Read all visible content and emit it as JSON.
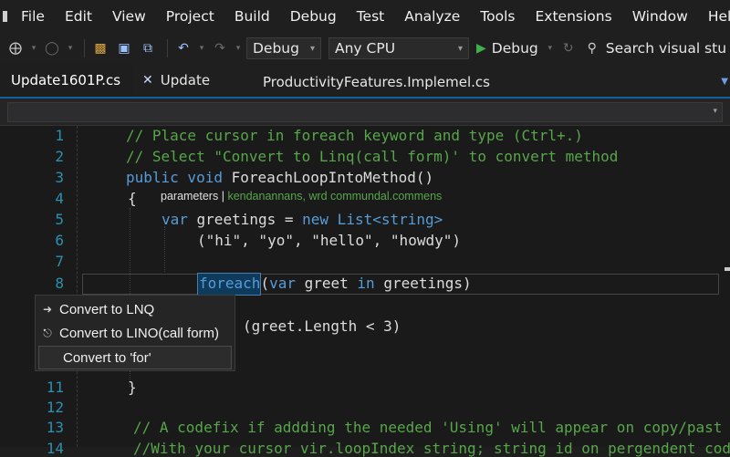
{
  "menu": [
    "File",
    "Edit",
    "View",
    "Project",
    "Build",
    "Debug",
    "Test",
    "Analyze",
    "Tools",
    "Extensions",
    "Window",
    "Help"
  ],
  "toolbar": {
    "configuration": "Debug",
    "platform": "Any CPU",
    "run_label": "Debug",
    "search_label": "Search visual stu"
  },
  "tabs": [
    {
      "label": "Update1601P.cs",
      "active": true
    },
    {
      "label": "Update",
      "active": false
    },
    {
      "label": "ProductivityFeatures.Implemel.cs",
      "active": false
    }
  ],
  "editor": {
    "line_numbers": [
      "1",
      "2",
      "3",
      "4",
      "5",
      "6",
      "7",
      "8",
      "11",
      "12",
      "13",
      "14"
    ],
    "lines": {
      "l1": "// Place cursor in foreach keyword and type (Ctrl+.)",
      "l2": "// Select \"Convert to Linq(call form)' to convert method",
      "l3_kw": "public void",
      "l3_name": " ForeachLoopIntoMethod()",
      "l4": "{",
      "l5_kw": "var",
      "l5_mid": " greetings = ",
      "l5_new": "new",
      "l5_type": " List<string>",
      "l6": "(\"hi\", \"yo\", \"hello\", \"howdy\")",
      "l8_kw": "foreach",
      "l8_open": "(",
      "l8_var": "var",
      "l8_mid": " greet ",
      "l8_in": "in",
      "l8_rest": " greetings)",
      "l9_rest": "(greet.Length < 3)",
      "l11": "}",
      "l13": "// A codefix if addding the needed 'Using' will appear on copy/past",
      "l14": "//With your cursor vir.loopIndex string; string id on pergendent code"
    },
    "hint": {
      "label": "parameters |",
      "value": "kendanannans, wrd  commundal.commens"
    }
  },
  "quick_actions": [
    {
      "label": "Convert to LNQ",
      "icon": "arrow-icon"
    },
    {
      "label": "Convert to LINO(call form)",
      "icon": "refactor-icon"
    },
    {
      "label": "Convert to 'for'",
      "icon": "none"
    }
  ]
}
